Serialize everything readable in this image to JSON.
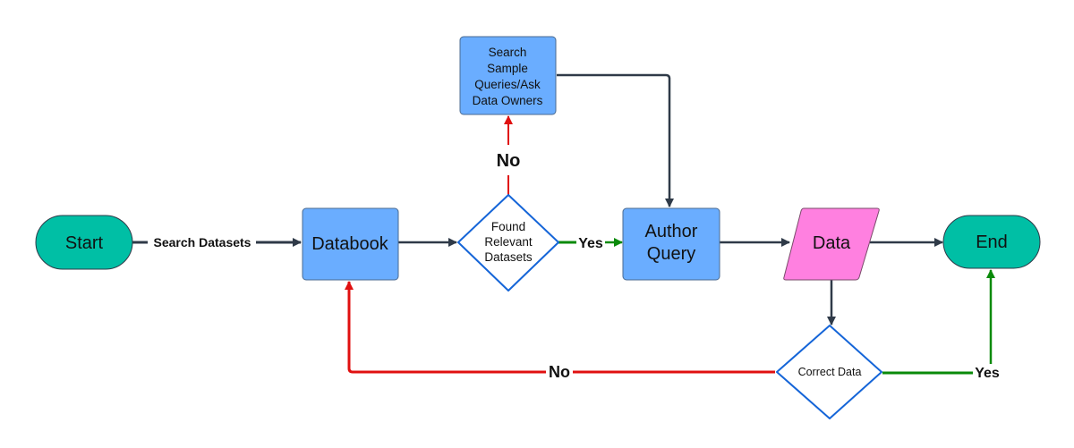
{
  "colors": {
    "terminal": "#00BFA5",
    "process": "#6AADFF",
    "data": "#FF80E0",
    "decision_stroke": "#1565D8",
    "connector": "#2F3A48",
    "no": "#E01010",
    "yes": "#0A8A0A"
  },
  "nodes": {
    "start": "Start",
    "databook": "Databook",
    "found_line1": "Found",
    "found_line2": "Relevant",
    "found_line3": "Datasets",
    "search_line1": "Search",
    "search_line2": "Sample",
    "search_line3": "Queries/Ask",
    "search_line4": "Data Owners",
    "author_line1": "Author",
    "author_line2": "Query",
    "data": "Data",
    "end": "End",
    "correct": "Correct Data"
  },
  "edges": {
    "search_datasets": "Search Datasets",
    "found_no": "No",
    "found_yes": "Yes",
    "correct_no": "No",
    "correct_yes": "Yes"
  }
}
